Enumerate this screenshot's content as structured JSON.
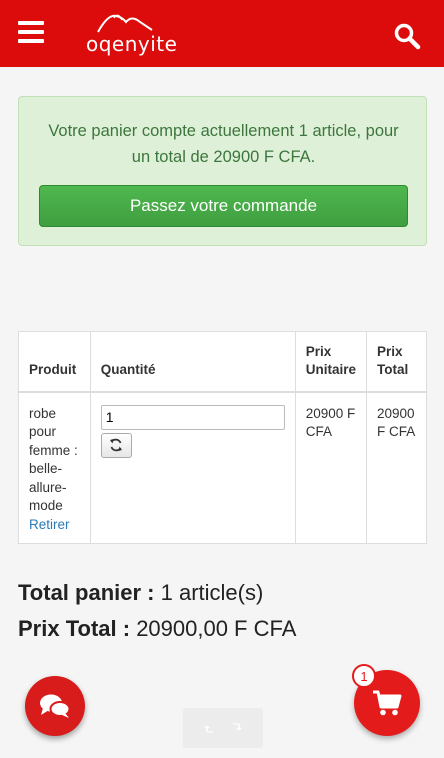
{
  "header": {
    "logo_text": "oqenyite",
    "menu_icon": "hamburger-icon",
    "search_icon": "search-icon",
    "background_color": "#dd0c0c"
  },
  "alert": {
    "message": "Votre panier compte actuellement 1 article, pour un total de 20900 F CFA.",
    "order_button_label": "Passez votre commande",
    "background_color": "#dff0d8",
    "text_color": "#3c763d",
    "button_color": "#43a843"
  },
  "cart_table": {
    "headers": {
      "product": "Produit",
      "quantity": "Quantité",
      "unit_price": "Prix Unitaire",
      "total_price": "Prix Total"
    },
    "rows": [
      {
        "product_name": "robe pour femme : belle-allure-mode",
        "remove_label": "Retirer",
        "quantity": "1",
        "unit_price": "20900 F CFA",
        "total_price": "20900 F CFA"
      }
    ]
  },
  "totals": {
    "cart_label": "Total panier :",
    "cart_value": "1 article(s)",
    "price_label": "Prix Total :",
    "price_value": "20900,00 F CFA"
  },
  "fabs": {
    "chat_icon": "chat-bubbles-icon",
    "cart_icon": "shopping-cart-icon",
    "cart_count": "1"
  },
  "nav": {
    "undo_icon": "undo-icon",
    "redo_icon": "redo-icon"
  }
}
